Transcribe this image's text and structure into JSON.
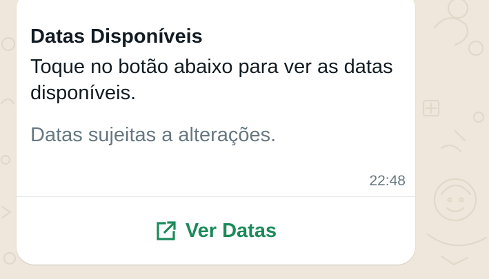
{
  "message": {
    "header": "Datas Disponíveis",
    "body": "Toque no botão abaixo para ver as datas disponíveis.",
    "footer": "Datas sujeitas a alterações.",
    "time": "22:48"
  },
  "action_button": {
    "label": "Ver Datas",
    "icon": "external-link-icon"
  },
  "colors": {
    "chat_background": "#efe7dc",
    "bubble_background": "#ffffff",
    "primary_text": "#111b21",
    "secondary_text": "#667781",
    "accent": "#1b8a5a"
  }
}
